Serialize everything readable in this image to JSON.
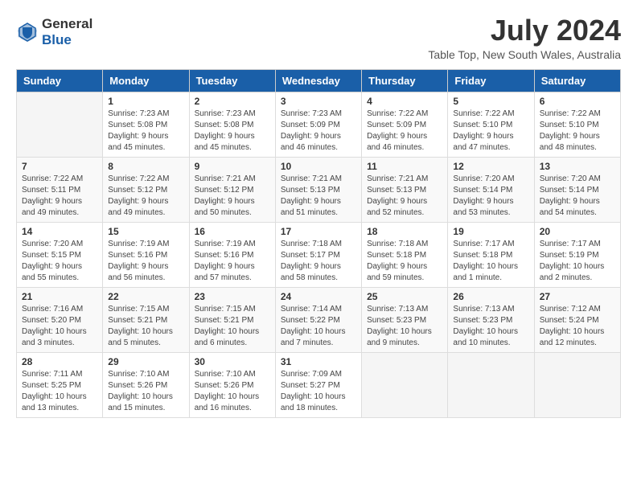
{
  "header": {
    "logo_line1": "General",
    "logo_line2": "Blue",
    "title": "July 2024",
    "location": "Table Top, New South Wales, Australia"
  },
  "calendar": {
    "days_of_week": [
      "Sunday",
      "Monday",
      "Tuesday",
      "Wednesday",
      "Thursday",
      "Friday",
      "Saturday"
    ],
    "weeks": [
      [
        {
          "day": "",
          "info": ""
        },
        {
          "day": "1",
          "info": "Sunrise: 7:23 AM\nSunset: 5:08 PM\nDaylight: 9 hours\nand 45 minutes."
        },
        {
          "day": "2",
          "info": "Sunrise: 7:23 AM\nSunset: 5:08 PM\nDaylight: 9 hours\nand 45 minutes."
        },
        {
          "day": "3",
          "info": "Sunrise: 7:23 AM\nSunset: 5:09 PM\nDaylight: 9 hours\nand 46 minutes."
        },
        {
          "day": "4",
          "info": "Sunrise: 7:22 AM\nSunset: 5:09 PM\nDaylight: 9 hours\nand 46 minutes."
        },
        {
          "day": "5",
          "info": "Sunrise: 7:22 AM\nSunset: 5:10 PM\nDaylight: 9 hours\nand 47 minutes."
        },
        {
          "day": "6",
          "info": "Sunrise: 7:22 AM\nSunset: 5:10 PM\nDaylight: 9 hours\nand 48 minutes."
        }
      ],
      [
        {
          "day": "7",
          "info": "Sunrise: 7:22 AM\nSunset: 5:11 PM\nDaylight: 9 hours\nand 49 minutes."
        },
        {
          "day": "8",
          "info": "Sunrise: 7:22 AM\nSunset: 5:12 PM\nDaylight: 9 hours\nand 49 minutes."
        },
        {
          "day": "9",
          "info": "Sunrise: 7:21 AM\nSunset: 5:12 PM\nDaylight: 9 hours\nand 50 minutes."
        },
        {
          "day": "10",
          "info": "Sunrise: 7:21 AM\nSunset: 5:13 PM\nDaylight: 9 hours\nand 51 minutes."
        },
        {
          "day": "11",
          "info": "Sunrise: 7:21 AM\nSunset: 5:13 PM\nDaylight: 9 hours\nand 52 minutes."
        },
        {
          "day": "12",
          "info": "Sunrise: 7:20 AM\nSunset: 5:14 PM\nDaylight: 9 hours\nand 53 minutes."
        },
        {
          "day": "13",
          "info": "Sunrise: 7:20 AM\nSunset: 5:14 PM\nDaylight: 9 hours\nand 54 minutes."
        }
      ],
      [
        {
          "day": "14",
          "info": "Sunrise: 7:20 AM\nSunset: 5:15 PM\nDaylight: 9 hours\nand 55 minutes."
        },
        {
          "day": "15",
          "info": "Sunrise: 7:19 AM\nSunset: 5:16 PM\nDaylight: 9 hours\nand 56 minutes."
        },
        {
          "day": "16",
          "info": "Sunrise: 7:19 AM\nSunset: 5:16 PM\nDaylight: 9 hours\nand 57 minutes."
        },
        {
          "day": "17",
          "info": "Sunrise: 7:18 AM\nSunset: 5:17 PM\nDaylight: 9 hours\nand 58 minutes."
        },
        {
          "day": "18",
          "info": "Sunrise: 7:18 AM\nSunset: 5:18 PM\nDaylight: 9 hours\nand 59 minutes."
        },
        {
          "day": "19",
          "info": "Sunrise: 7:17 AM\nSunset: 5:18 PM\nDaylight: 10 hours\nand 1 minute."
        },
        {
          "day": "20",
          "info": "Sunrise: 7:17 AM\nSunset: 5:19 PM\nDaylight: 10 hours\nand 2 minutes."
        }
      ],
      [
        {
          "day": "21",
          "info": "Sunrise: 7:16 AM\nSunset: 5:20 PM\nDaylight: 10 hours\nand 3 minutes."
        },
        {
          "day": "22",
          "info": "Sunrise: 7:15 AM\nSunset: 5:21 PM\nDaylight: 10 hours\nand 5 minutes."
        },
        {
          "day": "23",
          "info": "Sunrise: 7:15 AM\nSunset: 5:21 PM\nDaylight: 10 hours\nand 6 minutes."
        },
        {
          "day": "24",
          "info": "Sunrise: 7:14 AM\nSunset: 5:22 PM\nDaylight: 10 hours\nand 7 minutes."
        },
        {
          "day": "25",
          "info": "Sunrise: 7:13 AM\nSunset: 5:23 PM\nDaylight: 10 hours\nand 9 minutes."
        },
        {
          "day": "26",
          "info": "Sunrise: 7:13 AM\nSunset: 5:23 PM\nDaylight: 10 hours\nand 10 minutes."
        },
        {
          "day": "27",
          "info": "Sunrise: 7:12 AM\nSunset: 5:24 PM\nDaylight: 10 hours\nand 12 minutes."
        }
      ],
      [
        {
          "day": "28",
          "info": "Sunrise: 7:11 AM\nSunset: 5:25 PM\nDaylight: 10 hours\nand 13 minutes."
        },
        {
          "day": "29",
          "info": "Sunrise: 7:10 AM\nSunset: 5:26 PM\nDaylight: 10 hours\nand 15 minutes."
        },
        {
          "day": "30",
          "info": "Sunrise: 7:10 AM\nSunset: 5:26 PM\nDaylight: 10 hours\nand 16 minutes."
        },
        {
          "day": "31",
          "info": "Sunrise: 7:09 AM\nSunset: 5:27 PM\nDaylight: 10 hours\nand 18 minutes."
        },
        {
          "day": "",
          "info": ""
        },
        {
          "day": "",
          "info": ""
        },
        {
          "day": "",
          "info": ""
        }
      ]
    ]
  }
}
